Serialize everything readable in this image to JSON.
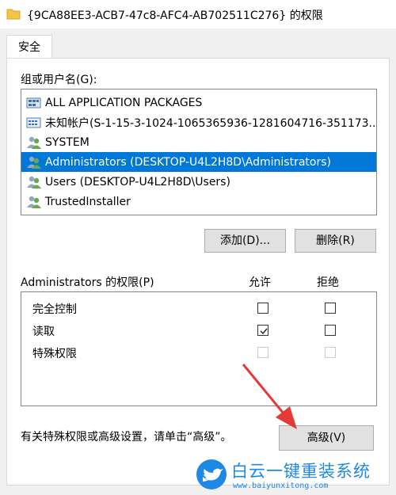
{
  "window": {
    "title": "{9CA88EE3-ACB7-47c8-AFC4-AB702511C276} 的权限"
  },
  "tabs": [
    {
      "label": "安全",
      "selected": true
    }
  ],
  "group_list": {
    "label": "组或用户名(G):",
    "items": [
      {
        "label": "ALL APPLICATION PACKAGES",
        "icon": "app-packages-icon",
        "selected": false
      },
      {
        "label": "未知帐户(S-1-15-3-1024-1065365936-1281604716-351173...",
        "icon": "unknown-account-icon",
        "selected": false
      },
      {
        "label": "SYSTEM",
        "icon": "user-group-icon",
        "selected": false
      },
      {
        "label": "Administrators (DESKTOP-U4L2H8D\\Administrators)",
        "icon": "user-group-icon",
        "selected": true
      },
      {
        "label": "Users (DESKTOP-U4L2H8D\\Users)",
        "icon": "user-group-icon",
        "selected": false
      },
      {
        "label": "TrustedInstaller",
        "icon": "user-group-icon",
        "selected": false
      }
    ]
  },
  "buttons": {
    "add": "添加(D)...",
    "remove": "删除(R)",
    "advanced": "高级(V)"
  },
  "permissions": {
    "label": "Administrators 的权限(P)",
    "allow_header": "允许",
    "deny_header": "拒绝",
    "rows": [
      {
        "name": "完全控制",
        "allow": false,
        "deny": false,
        "enabled": true
      },
      {
        "name": "读取",
        "allow": true,
        "deny": false,
        "enabled": true
      },
      {
        "name": "特殊权限",
        "allow": false,
        "deny": false,
        "enabled": false
      }
    ]
  },
  "advanced_hint": "有关特殊权限或高级设置，请单击“高级”。",
  "watermark": {
    "name": "白云一键重装系统",
    "url": "www.baiyunxitong.com"
  },
  "colors": {
    "selection": "#0078d7",
    "annotation_arrow": "#e53935",
    "watermark": "#1e88e5"
  }
}
